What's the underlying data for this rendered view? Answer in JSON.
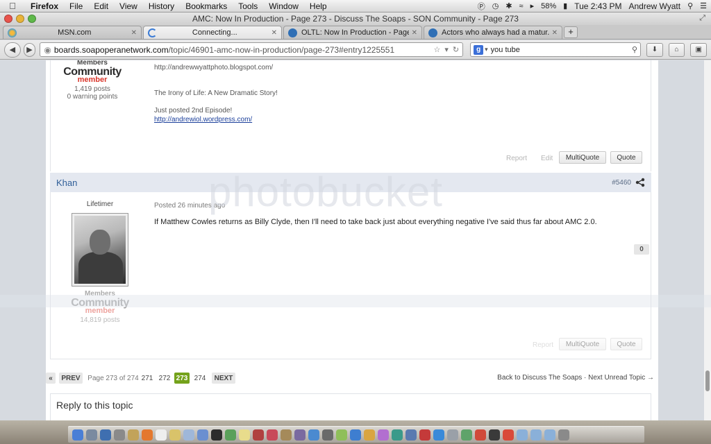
{
  "menubar": {
    "app": "Firefox",
    "items": [
      "File",
      "Edit",
      "View",
      "History",
      "Bookmarks",
      "Tools",
      "Window",
      "Help"
    ],
    "battery": "58%",
    "clock": "Tue 2:43 PM",
    "user": "Andrew Wyatt"
  },
  "window": {
    "title": "AMC: Now In Production - Page 273 - Discuss The Soaps - SON Community - Page 273"
  },
  "tabs": [
    {
      "label": "MSN.com"
    },
    {
      "label": "Connecting..."
    },
    {
      "label": "OLTL: Now In Production - Page..."
    },
    {
      "label": "Actors who always had a matur..."
    }
  ],
  "navbar": {
    "url_host": "boards.soapoperanetwork.com",
    "url_path": "/topic/46901-amc-now-in-production/page-273#entry1225551",
    "search_value": "you tube"
  },
  "post1": {
    "group": "Members",
    "logo_main": "Community",
    "logo_sub": "member",
    "posts": "1,419 posts",
    "warnings": "0 warning points",
    "sig_link1": "http://andrewwyattphoto.blogspot.com/",
    "sig_line1": "The Irony of Life: A New Dramatic Story!",
    "sig_line2": "Just posted 2nd Episode!",
    "sig_link2": "http://andrewiol.wordpress.com/",
    "report": "Report",
    "edit": "Edit",
    "multiquote": "MultiQuote",
    "quote": "Quote"
  },
  "post2": {
    "author": "Khan",
    "number": "#5460",
    "rank": "Lifetimer",
    "posted": "Posted 26 minutes ago",
    "body": "If Matthew Cowles returns as Billy Clyde, then I'll need to take back just about everything negative I've said thus far about AMC 2.0.",
    "votes": "0",
    "group": "Members",
    "logo_main": "Community",
    "logo_sub": "member",
    "posts": "14,819 posts",
    "report": "Report",
    "multiquote": "MultiQuote",
    "quote": "Quote"
  },
  "pagination": {
    "first": "«",
    "prev": "PREV",
    "info": "Page 273 of 274",
    "p271": "271",
    "p272": "272",
    "p273": "273",
    "p274": "274",
    "next": "NEXT",
    "backlink": "Back to Discuss The Soaps · Next Unread Topic →"
  },
  "reply": {
    "title": "Reply to this topic"
  },
  "watermark": "photobucket",
  "colors": {
    "accent_green": "#74a21b",
    "author_blue": "#2f5e98",
    "header_bg": "#e4e8f0"
  }
}
